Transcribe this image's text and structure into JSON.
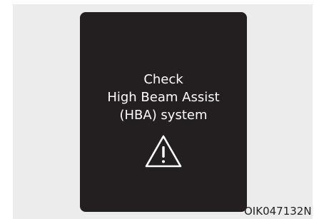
{
  "screen": {
    "message_lines": [
      "Check",
      "High Beam Assist",
      "(HBA) system"
    ],
    "icon": "warning-triangle-icon"
  },
  "caption": "OIK047132N",
  "colors": {
    "screen_bg": "#231f20",
    "frame_bg": "#ececec",
    "text": "#ffffff"
  }
}
